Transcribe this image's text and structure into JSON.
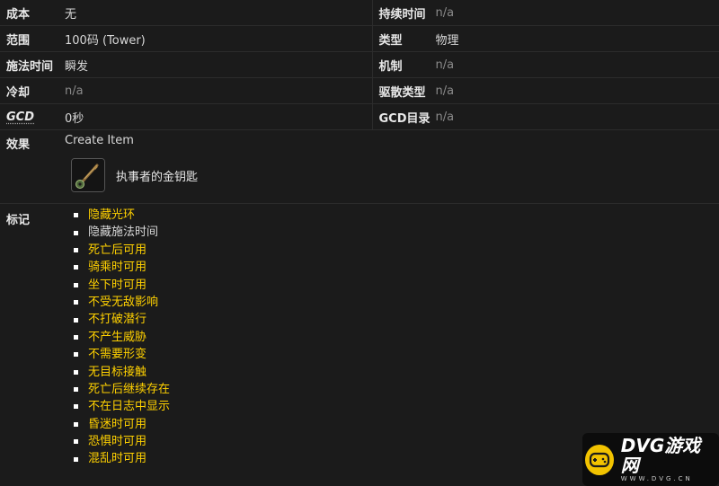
{
  "rows": [
    {
      "left_label": "成本",
      "left_value": "无",
      "right_label": "持续时间",
      "right_value": "n/a"
    },
    {
      "left_label": "范围",
      "left_value": "100码 (Tower)",
      "right_label": "类型",
      "right_value": "物理"
    },
    {
      "left_label": "施法时间",
      "left_value": "瞬发",
      "right_label": "机制",
      "right_value": "n/a"
    },
    {
      "left_label": "冷却",
      "left_value": "n/a",
      "right_label": "驱散类型",
      "right_value": "n/a"
    },
    {
      "left_label": "GCD",
      "left_value": "0秒",
      "right_label": "GCD目录",
      "right_value": "n/a"
    }
  ],
  "effect": {
    "label": "效果",
    "value": "Create Item",
    "item_name": "执事者的金钥匙",
    "item_icon": "golden-key-icon"
  },
  "flags": {
    "label": "标记",
    "items": [
      "隐藏光环",
      "隐藏施法时间",
      "死亡后可用",
      "骑乘时可用",
      "坐下时可用",
      "不受无敌影响",
      "不打破潜行",
      "不产生威胁",
      "不需要形变",
      "无目标接触",
      "死亡后继续存在",
      "不在日志中显示",
      "昏迷时可用",
      "恐惧时可用",
      "混乱时可用"
    ]
  },
  "watermark": {
    "main": "DVG游戏网",
    "sub": "WWW.DVG.CN"
  },
  "colors": {
    "highlight": "#ffd100",
    "muted": "#8a8a8a",
    "background": "#1b1b1b"
  }
}
